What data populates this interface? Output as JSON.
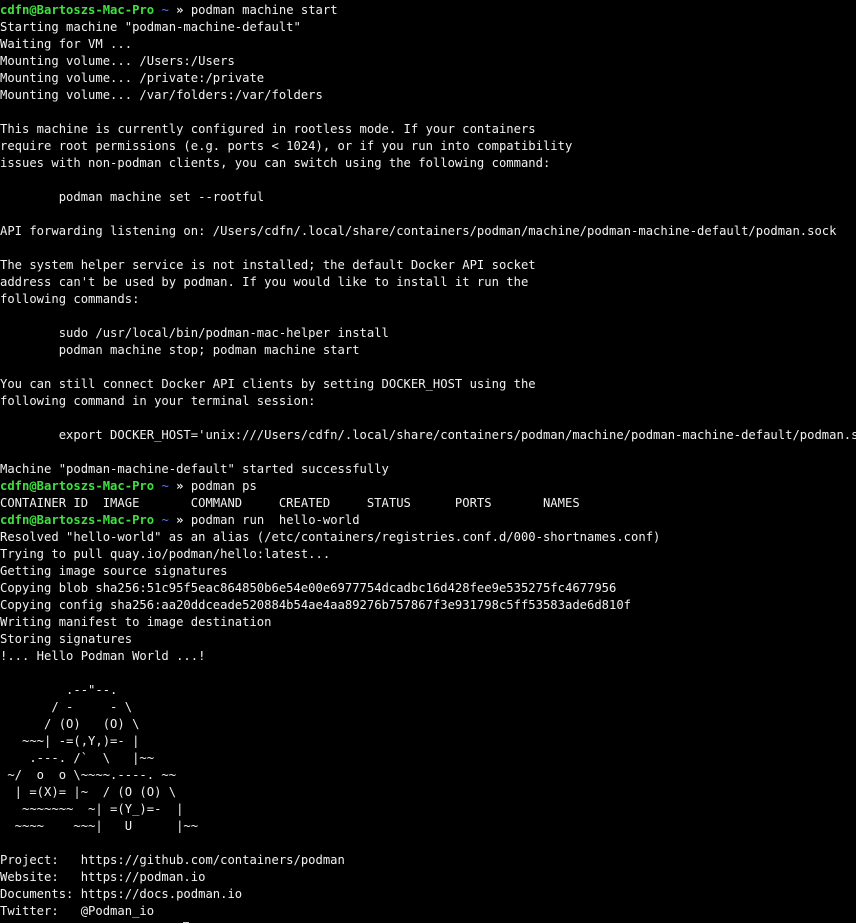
{
  "colors": {
    "background": "#000000",
    "text": "#f2f2f2",
    "prompt_user": "#3fe03f",
    "prompt_path": "#5a79ff"
  },
  "terminal": {
    "lines": [
      {
        "type": "prompt",
        "user": "cdfn@Bartoszs-Mac-Pro",
        "path": "~",
        "arrow": "»",
        "command": "podman machine start"
      },
      {
        "type": "out",
        "text": "Starting machine \"podman-machine-default\""
      },
      {
        "type": "out",
        "text": "Waiting for VM ..."
      },
      {
        "type": "out",
        "text": "Mounting volume... /Users:/Users"
      },
      {
        "type": "out",
        "text": "Mounting volume... /private:/private"
      },
      {
        "type": "out",
        "text": "Mounting volume... /var/folders:/var/folders"
      },
      {
        "type": "out",
        "text": ""
      },
      {
        "type": "out",
        "text": "This machine is currently configured in rootless mode. If your containers"
      },
      {
        "type": "out",
        "text": "require root permissions (e.g. ports < 1024), or if you run into compatibility"
      },
      {
        "type": "out",
        "text": "issues with non-podman clients, you can switch using the following command:"
      },
      {
        "type": "out",
        "text": ""
      },
      {
        "type": "out",
        "text": "        podman machine set --rootful"
      },
      {
        "type": "out",
        "text": ""
      },
      {
        "type": "out",
        "text": "API forwarding listening on: /Users/cdfn/.local/share/containers/podman/machine/podman-machine-default/podman.sock"
      },
      {
        "type": "out",
        "text": ""
      },
      {
        "type": "out",
        "text": "The system helper service is not installed; the default Docker API socket"
      },
      {
        "type": "out",
        "text": "address can't be used by podman. If you would like to install it run the"
      },
      {
        "type": "out",
        "text": "following commands:"
      },
      {
        "type": "out",
        "text": ""
      },
      {
        "type": "out",
        "text": "        sudo /usr/local/bin/podman-mac-helper install"
      },
      {
        "type": "out",
        "text": "        podman machine stop; podman machine start"
      },
      {
        "type": "out",
        "text": ""
      },
      {
        "type": "out",
        "text": "You can still connect Docker API clients by setting DOCKER_HOST using the"
      },
      {
        "type": "out",
        "text": "following command in your terminal session:"
      },
      {
        "type": "out",
        "text": ""
      },
      {
        "type": "out",
        "text": "        export DOCKER_HOST='unix:///Users/cdfn/.local/share/containers/podman/machine/podman-machine-default/podman.sock'"
      },
      {
        "type": "out",
        "text": ""
      },
      {
        "type": "out",
        "text": "Machine \"podman-machine-default\" started successfully"
      },
      {
        "type": "prompt",
        "user": "cdfn@Bartoszs-Mac-Pro",
        "path": "~",
        "arrow": "»",
        "command": "podman ps"
      },
      {
        "type": "out",
        "text": "CONTAINER ID  IMAGE       COMMAND     CREATED     STATUS      PORTS       NAMES"
      },
      {
        "type": "prompt",
        "user": "cdfn@Bartoszs-Mac-Pro",
        "path": "~",
        "arrow": "»",
        "command": "podman run  hello-world"
      },
      {
        "type": "out",
        "text": "Resolved \"hello-world\" as an alias (/etc/containers/registries.conf.d/000-shortnames.conf)"
      },
      {
        "type": "out",
        "text": "Trying to pull quay.io/podman/hello:latest..."
      },
      {
        "type": "out",
        "text": "Getting image source signatures"
      },
      {
        "type": "out",
        "text": "Copying blob sha256:51c95f5eac864850b6e54e00e6977754dcadbc16d428fee9e535275fc4677956"
      },
      {
        "type": "out",
        "text": "Copying config sha256:aa20ddceade520884b54ae4aa89276b757867f3e931798c5ff53583ade6d810f"
      },
      {
        "type": "out",
        "text": "Writing manifest to image destination"
      },
      {
        "type": "out",
        "text": "Storing signatures"
      },
      {
        "type": "out",
        "text": "!... Hello Podman World ...!"
      },
      {
        "type": "out",
        "text": ""
      },
      {
        "type": "out",
        "text": "         .--\"--."
      },
      {
        "type": "out",
        "text": "       / -     - \\"
      },
      {
        "type": "out",
        "text": "      / (O)   (O) \\"
      },
      {
        "type": "out",
        "text": "   ~~~| -=(,Y,)=- |"
      },
      {
        "type": "out",
        "text": "    .---. /`  \\   |~~"
      },
      {
        "type": "out",
        "text": " ~/  o  o \\~~~~.----. ~~"
      },
      {
        "type": "out",
        "text": "  | =(X)= |~  / (O (O) \\"
      },
      {
        "type": "out",
        "text": "   ~~~~~~~  ~| =(Y_)=-  |"
      },
      {
        "type": "out",
        "text": "  ~~~~    ~~~|   U      |~~"
      },
      {
        "type": "out",
        "text": ""
      },
      {
        "type": "out",
        "text": "Project:   https://github.com/containers/podman"
      },
      {
        "type": "out",
        "text": "Website:   https://podman.io"
      },
      {
        "type": "out",
        "text": "Documents: https://docs.podman.io"
      },
      {
        "type": "out",
        "text": "Twitter:   @Podman_io"
      }
    ]
  },
  "cursor": {
    "icon": "block-cursor-icon"
  }
}
